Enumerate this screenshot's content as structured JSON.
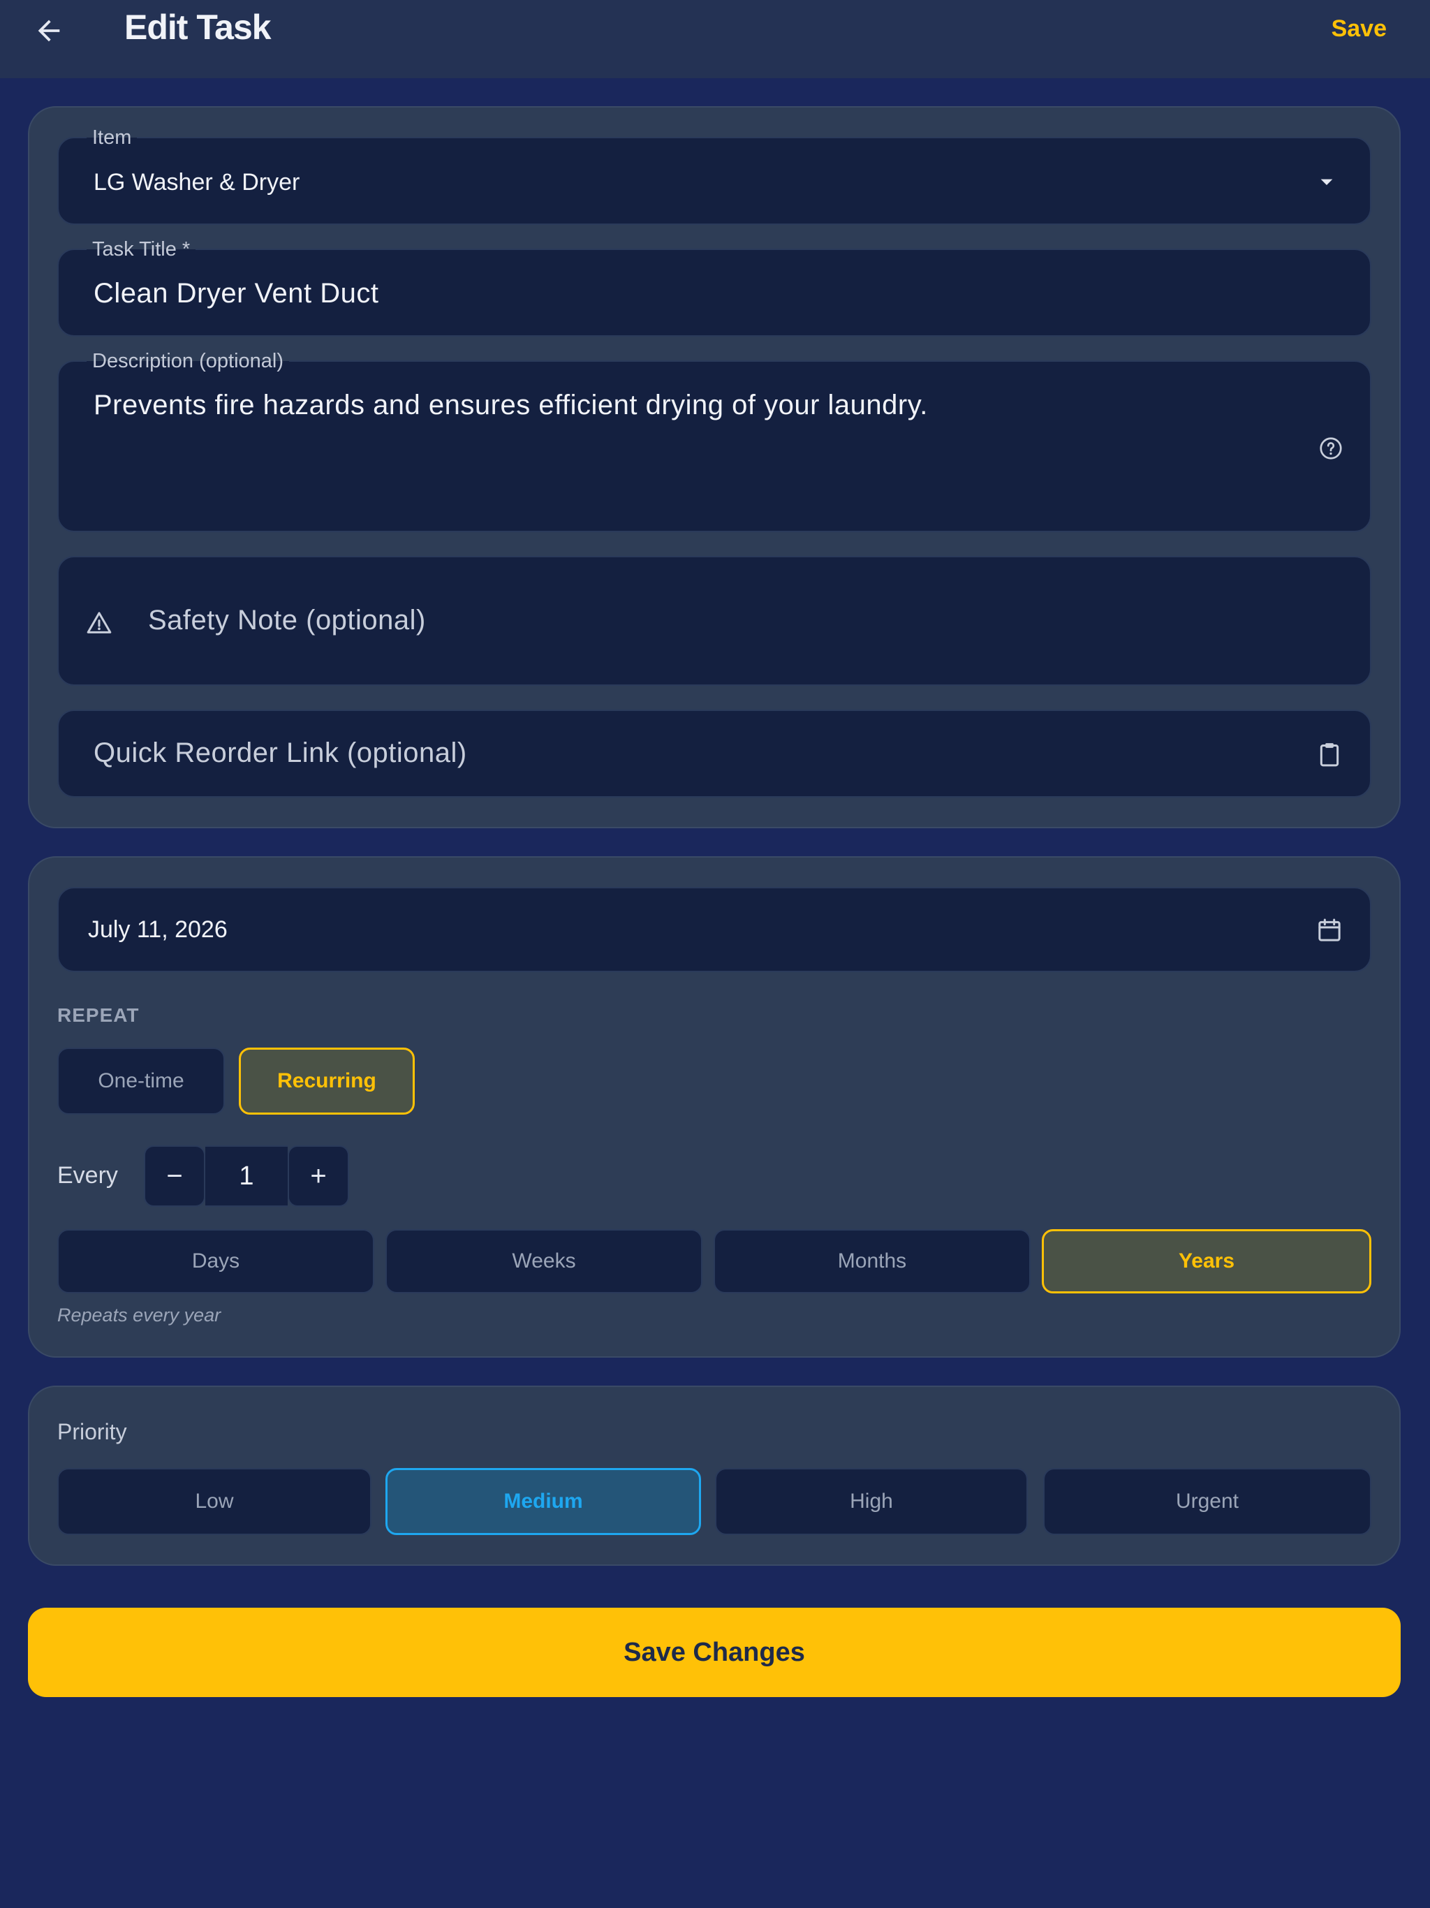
{
  "appbar": {
    "title": "Edit Task",
    "save_label": "Save"
  },
  "form": {
    "item": {
      "label": "Item",
      "value": "LG Washer & Dryer"
    },
    "title": {
      "label": "Task Title *",
      "value": "Clean Dryer Vent Duct"
    },
    "description": {
      "label": "Description (optional)",
      "value": "Prevents fire hazards and ensures efficient drying of your laundry."
    },
    "safety": {
      "placeholder": "Safety Note (optional)"
    },
    "reorder": {
      "placeholder": "Quick Reorder Link (optional)"
    }
  },
  "schedule": {
    "date": "July 11, 2026",
    "repeat_label": "REPEAT",
    "repeat_options": [
      "One-time",
      "Recurring"
    ],
    "repeat_selected": "Recurring",
    "every_label": "Every",
    "interval": "1",
    "decrement": "−",
    "increment": "+",
    "units": [
      "Days",
      "Weeks",
      "Months",
      "Years"
    ],
    "unit_selected": "Years",
    "hint": "Repeats every year"
  },
  "priority": {
    "label": "Priority",
    "options": [
      "Low",
      "Medium",
      "High",
      "Urgent"
    ],
    "selected": "Medium"
  },
  "submit_label": "Save Changes",
  "colors": {
    "accent": "#ffc107",
    "selected_blue": "#1ea7f0",
    "background": "#1a275c",
    "card": "#2e3d56",
    "field": "#142040"
  },
  "icons": [
    "back-arrow-icon",
    "chevron-down-icon",
    "help-circle-icon",
    "warning-icon",
    "clipboard-icon",
    "calendar-icon"
  ]
}
